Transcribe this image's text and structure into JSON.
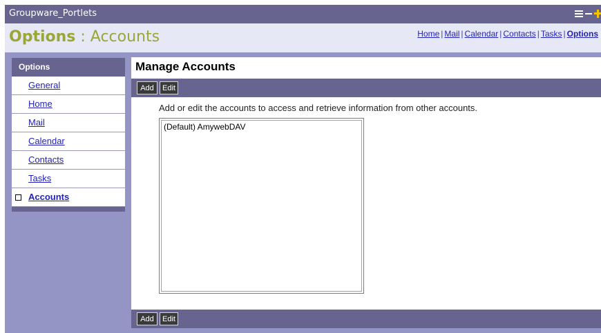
{
  "window": {
    "title": "Groupware_Portlets",
    "controls": [
      "list-icon",
      "minimize-icon",
      "maximize-icon"
    ]
  },
  "header": {
    "title_bold": "Options",
    "title_rest": " : Accounts"
  },
  "topnav": {
    "items": [
      "Home",
      "Mail",
      "Calendar",
      "Contacts",
      "Tasks",
      "Options"
    ],
    "separator": "|",
    "active": "Options"
  },
  "sidebar": {
    "heading": "Options",
    "items": [
      "General",
      "Home",
      "Mail",
      "Calendar",
      "Contacts",
      "Tasks",
      "Accounts"
    ],
    "active": "Accounts"
  },
  "main": {
    "title": "Manage Accounts",
    "add_label": "Add",
    "edit_label": "Edit",
    "description": "Add or edit the accounts to access and retrieve information from other accounts.",
    "accounts": [
      "(Default) AmywebDAV"
    ]
  },
  "colors": {
    "titlebar": "#67648f",
    "portlet_bg": "#9595c5",
    "header_bg": "#e7e8f6",
    "title_accent": "#9aa638",
    "link": "#1f1fb8",
    "button_bg": "#3a3a3a"
  }
}
